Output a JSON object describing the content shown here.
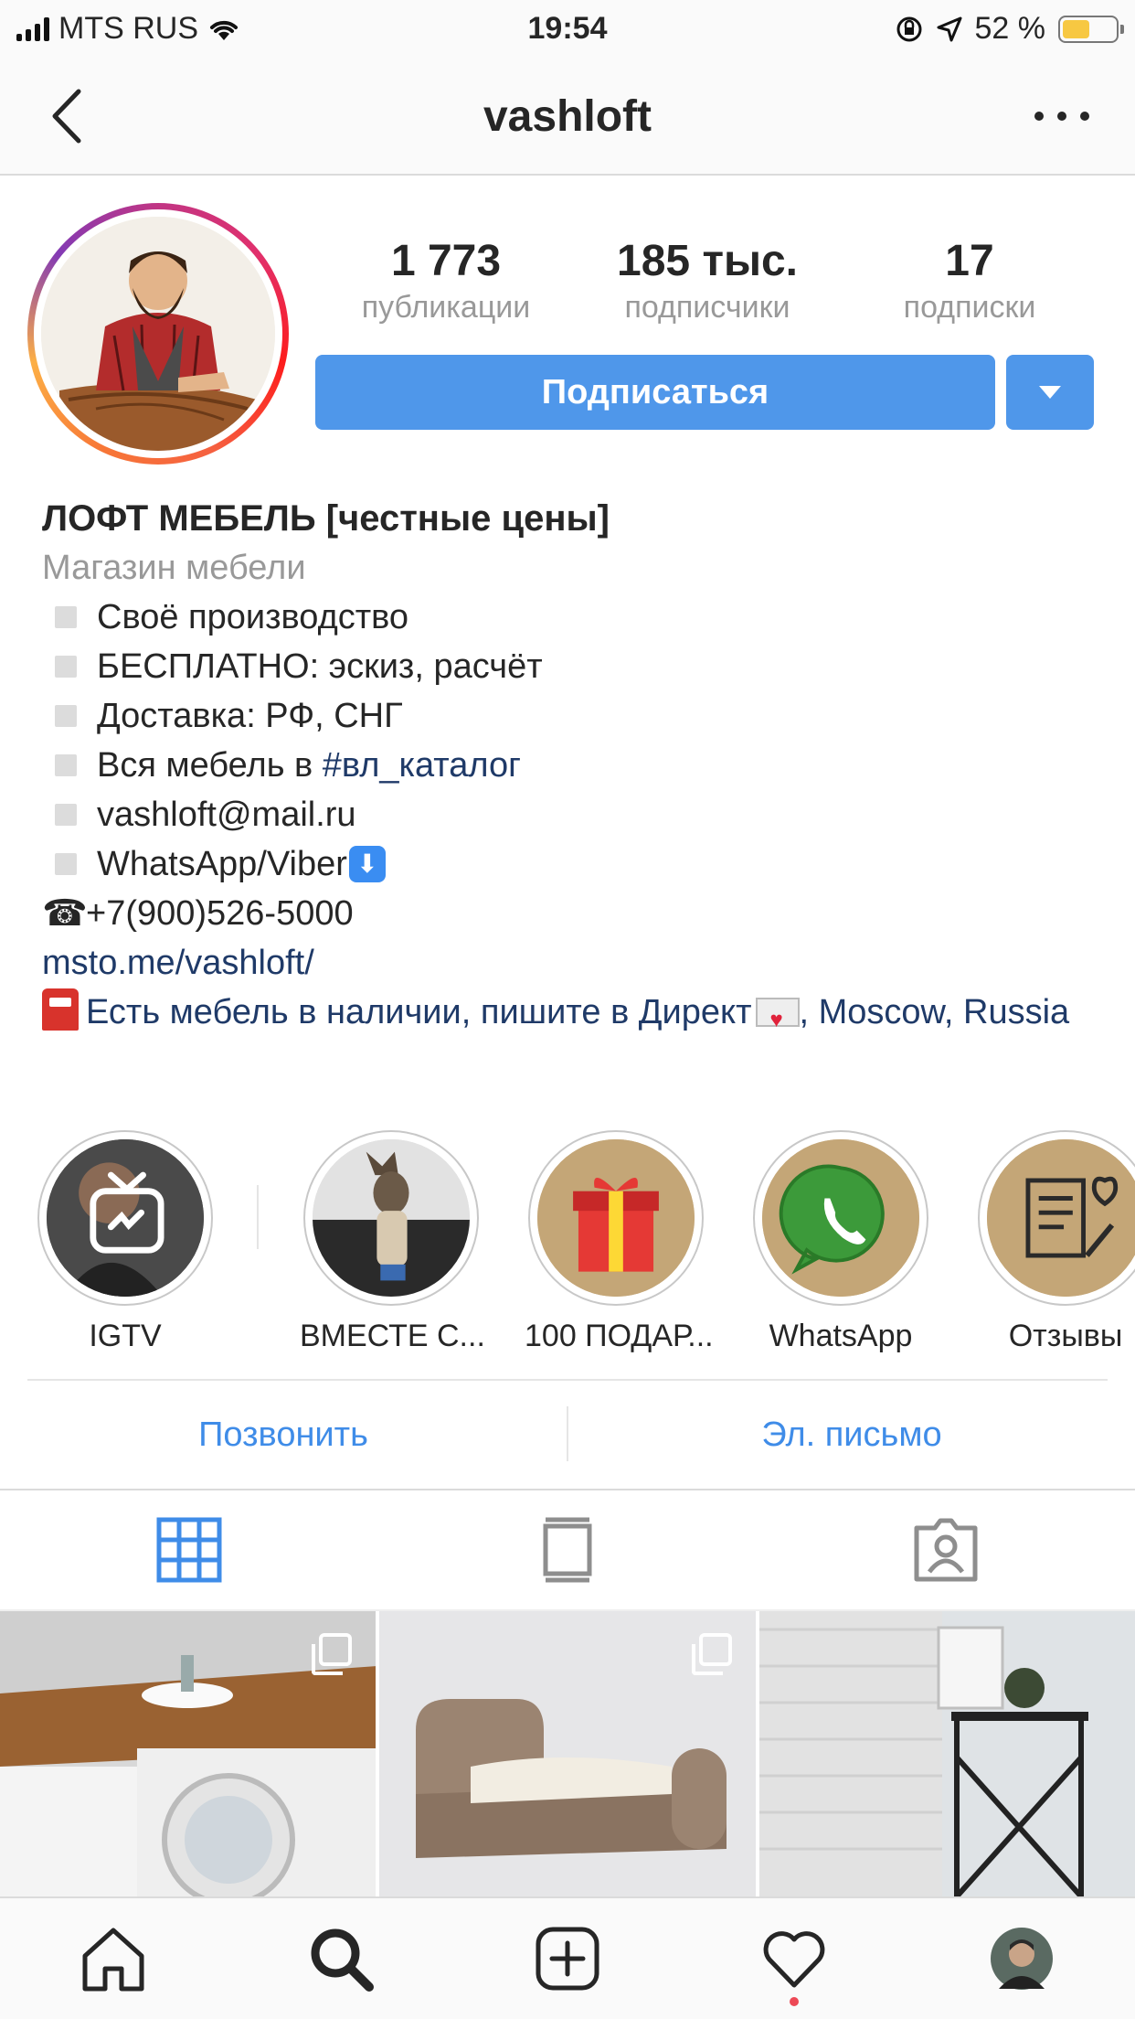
{
  "status_bar": {
    "carrier": "MTS RUS",
    "time": "19:54",
    "battery_percent": "52 %",
    "battery_level": 0.52
  },
  "header": {
    "username": "vashloft",
    "back_icon": "chevron-left-icon",
    "more_icon": "ellipsis-icon"
  },
  "profile": {
    "stats": [
      {
        "value": "1 773",
        "label": "публикации"
      },
      {
        "value": "185 тыс.",
        "label": "подписчики"
      },
      {
        "value": "17",
        "label": "подписки"
      }
    ],
    "follow_label": "Подписаться",
    "display_name": "ЛОФТ МЕБЕЛЬ [честные цены]",
    "category": "Магазин мебели",
    "bio_items": [
      "Своё производство",
      "БЕСПЛАТНО: эскиз, расчёт",
      "Доставка: РФ, СНГ",
      "Вся мебель в ",
      "vashloft@mail.ru",
      "WhatsApp/Viber"
    ],
    "catalog_hashtag": "#вл_каталог",
    "phone": "+7(900)526-5000",
    "website": "msto.me/vashloft/",
    "location_text": "Есть мебель в наличии, пишите в Директ",
    "location_suffix": ", Moscow, Russia"
  },
  "highlights": [
    {
      "label": "IGTV",
      "icon": "igtv-icon"
    },
    {
      "label": "ВМЕСТЕ С...",
      "icon": "moose-toy-icon"
    },
    {
      "label": "100 ПОДАР...",
      "icon": "gift-icon"
    },
    {
      "label": "WhatsApp",
      "icon": "whatsapp-icon"
    },
    {
      "label": "Отзывы",
      "icon": "reviews-icon"
    }
  ],
  "contact": {
    "call_label": "Позвонить",
    "email_label": "Эл. письмо"
  },
  "colors": {
    "accent": "#4f97ea",
    "link": "#1f3a68",
    "contact_blue": "#3f8ce8",
    "muted": "#999999",
    "notification": "#ed4956"
  },
  "tabs": [
    "grid-icon",
    "feed-icon",
    "tagged-icon"
  ],
  "bottom_nav": [
    "home-icon",
    "search-icon",
    "add-post-icon",
    "activity-heart-icon",
    "profile-avatar"
  ]
}
